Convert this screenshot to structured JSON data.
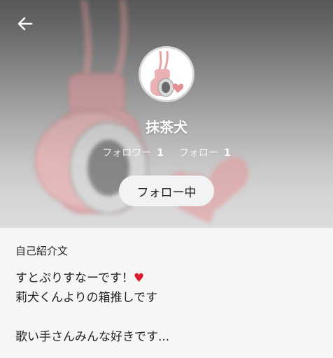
{
  "profile": {
    "name": "抹茶犬",
    "followers_label": "フォロワー",
    "followers_count": "1",
    "following_label": "フォロー",
    "following_count": "1",
    "follow_button_label": "フォロー中"
  },
  "bio": {
    "section_title": "自己紹介文",
    "text": "すとぷりすなーです！♥\n莉犬くんよりの箱推しです\n\n歌い手さんみんな好きです..."
  },
  "colors": {
    "heart": "#e01a2e",
    "art_pink": "#e6a3a6",
    "follow_button_bg": "#f1f3f5"
  },
  "icons": {
    "back": "arrow-left-icon"
  }
}
